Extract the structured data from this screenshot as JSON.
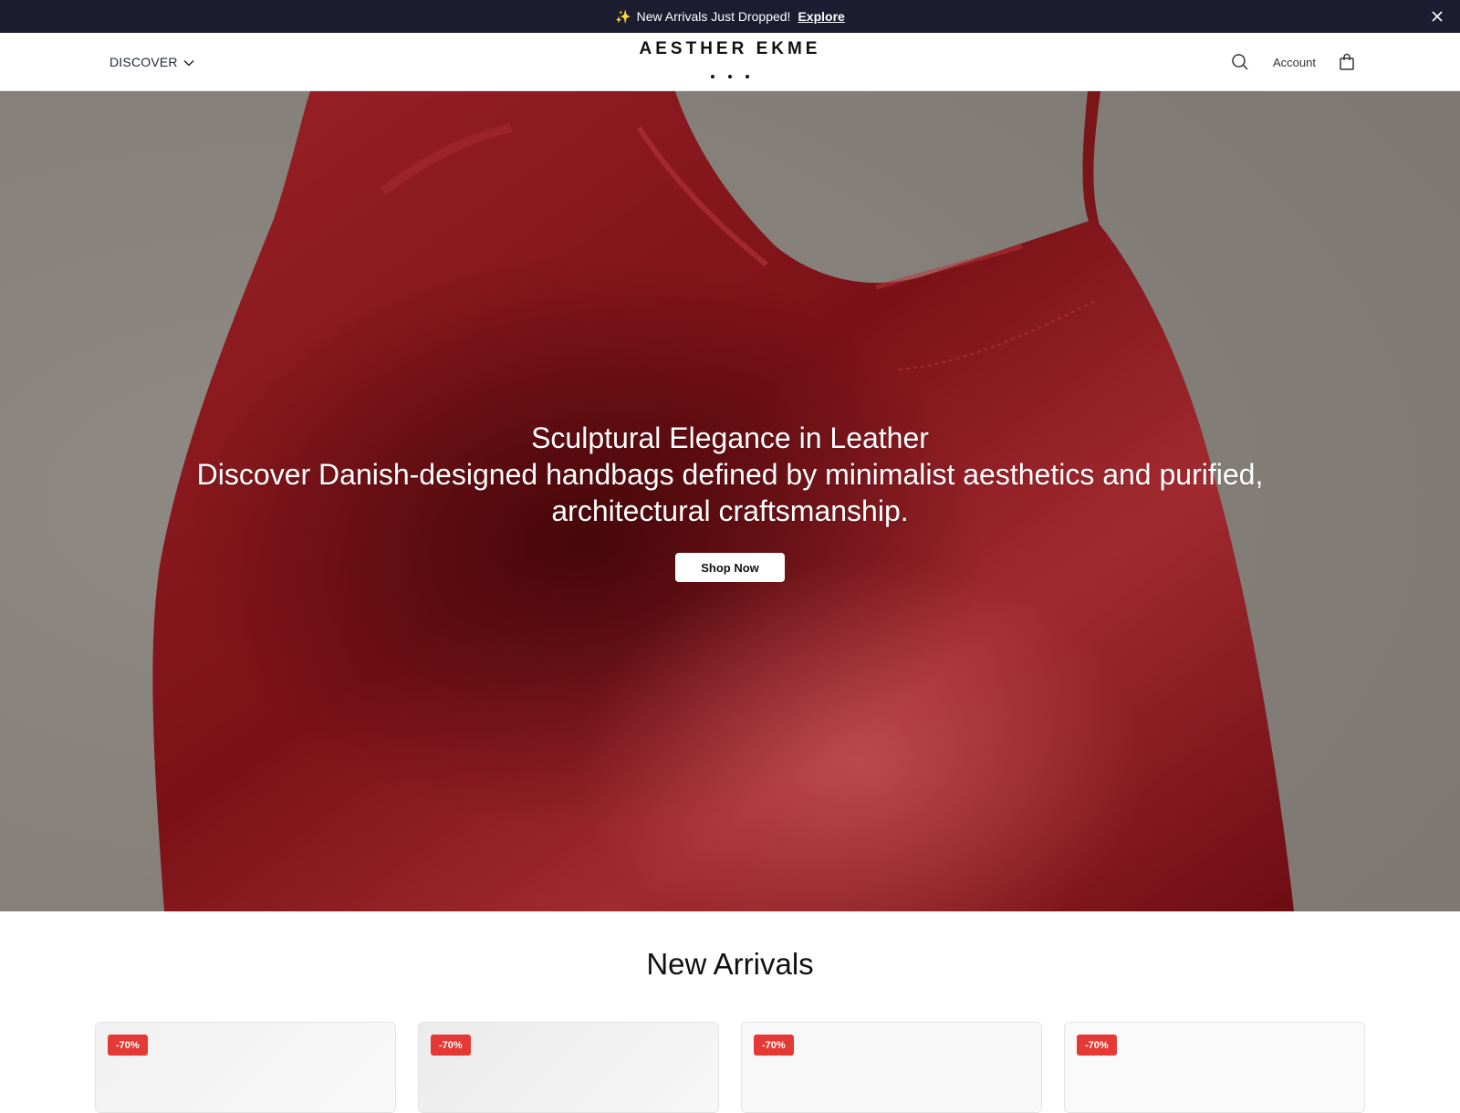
{
  "announcement": {
    "sparkle": "✨",
    "message": "New Arrivals Just Dropped!",
    "link": "Explore",
    "close_icon": "close-icon"
  },
  "header": {
    "menu_label": "DISCOVER",
    "menu_icon": "chevron-down-icon",
    "logo": "AESTHER EKME",
    "search_icon": "search-icon",
    "account_label": "Account",
    "bag_icon": "shopping-bag-icon"
  },
  "hero": {
    "title": "Sculptural Elegance in Leather",
    "subtitle": "Discover Danish-designed handbags defined by minimalist aesthetics and purified, architectural craftsmanship.",
    "cta": "Shop Now",
    "colors": {
      "background": "#8a8480",
      "bag": "#8e1a1e",
      "bag_shadow": "#5e0c10"
    }
  },
  "new_arrivals": {
    "title": "New Arrivals",
    "products": [
      {
        "badge": "-70%"
      },
      {
        "badge": "-70%"
      },
      {
        "badge": "-70%"
      },
      {
        "badge": "-70%"
      }
    ]
  },
  "colors": {
    "announcement_bg": "#1c1d31",
    "badge": "#e53935"
  }
}
